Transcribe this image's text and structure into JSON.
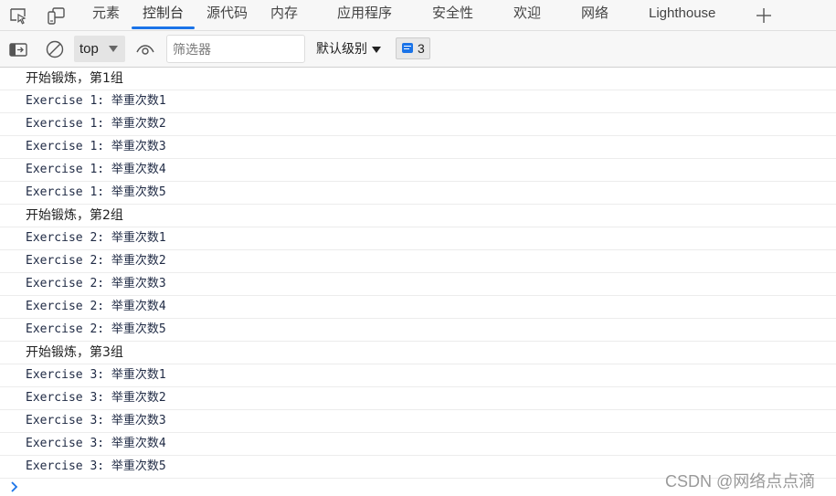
{
  "tabs": {
    "items": [
      {
        "label": "元素"
      },
      {
        "label": "控制台",
        "active": true
      },
      {
        "label": "源代码"
      },
      {
        "label": "内存"
      },
      {
        "label": "应用程序"
      },
      {
        "label": "安全性"
      },
      {
        "label": "欢迎"
      },
      {
        "label": "网络"
      },
      {
        "label": "Lighthouse"
      }
    ],
    "add_label": "+"
  },
  "toolbar": {
    "context": "top",
    "filter_placeholder": "筛选器",
    "filter_value": "",
    "level_label": "默认级别",
    "message_count": "3"
  },
  "console": {
    "rows": [
      {
        "text": "开始锻炼，第1组",
        "kind": "cjk"
      },
      {
        "text": "Exercise 1: 举重次数1",
        "kind": "mono"
      },
      {
        "text": "Exercise 1: 举重次数2",
        "kind": "mono"
      },
      {
        "text": "Exercise 1: 举重次数3",
        "kind": "mono"
      },
      {
        "text": "Exercise 1: 举重次数4",
        "kind": "mono"
      },
      {
        "text": "Exercise 1: 举重次数5",
        "kind": "mono"
      },
      {
        "text": "开始锻炼，第2组",
        "kind": "cjk"
      },
      {
        "text": "Exercise 2: 举重次数1",
        "kind": "mono"
      },
      {
        "text": "Exercise 2: 举重次数2",
        "kind": "mono"
      },
      {
        "text": "Exercise 2: 举重次数3",
        "kind": "mono"
      },
      {
        "text": "Exercise 2: 举重次数4",
        "kind": "mono"
      },
      {
        "text": "Exercise 2: 举重次数5",
        "kind": "mono"
      },
      {
        "text": "开始锻炼，第3组",
        "kind": "cjk"
      },
      {
        "text": "Exercise 3: 举重次数1",
        "kind": "mono"
      },
      {
        "text": "Exercise 3: 举重次数2",
        "kind": "mono"
      },
      {
        "text": "Exercise 3: 举重次数3",
        "kind": "mono"
      },
      {
        "text": "Exercise 3: 举重次数4",
        "kind": "mono"
      },
      {
        "text": "Exercise 3: 举重次数5",
        "kind": "mono"
      }
    ]
  },
  "watermark": "CSDN @网络点点滴",
  "colors": {
    "accent": "#1a73e8",
    "prompt": "#1a73e8"
  }
}
